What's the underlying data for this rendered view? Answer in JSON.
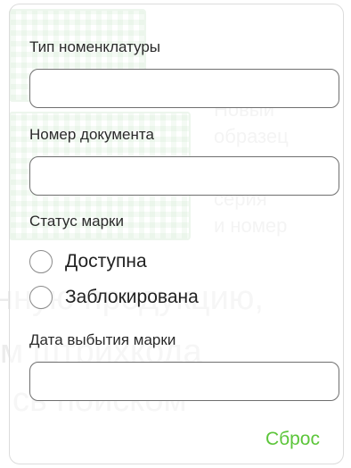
{
  "background": {
    "caption_lines": [
      "Новый",
      "образец",
      "серия",
      "и номер"
    ],
    "big_lines": [
      "нную продукцию,",
      "м штрихкода",
      "сь поиском"
    ]
  },
  "filters": {
    "nomenclature_type": {
      "label": "Тип номенклатуры",
      "value": ""
    },
    "document_number": {
      "label": "Номер документа",
      "value": ""
    },
    "mark_status": {
      "label": "Статус марки",
      "options": [
        {
          "label": "Доступна",
          "selected": false
        },
        {
          "label": "Заблокирована",
          "selected": false
        }
      ]
    },
    "mark_disposal_date": {
      "label": "Дата выбытия марки",
      "value": ""
    },
    "reset_label": "Сброс"
  },
  "colors": {
    "accent": "#5cc53a",
    "border": "#6f6f6f"
  }
}
